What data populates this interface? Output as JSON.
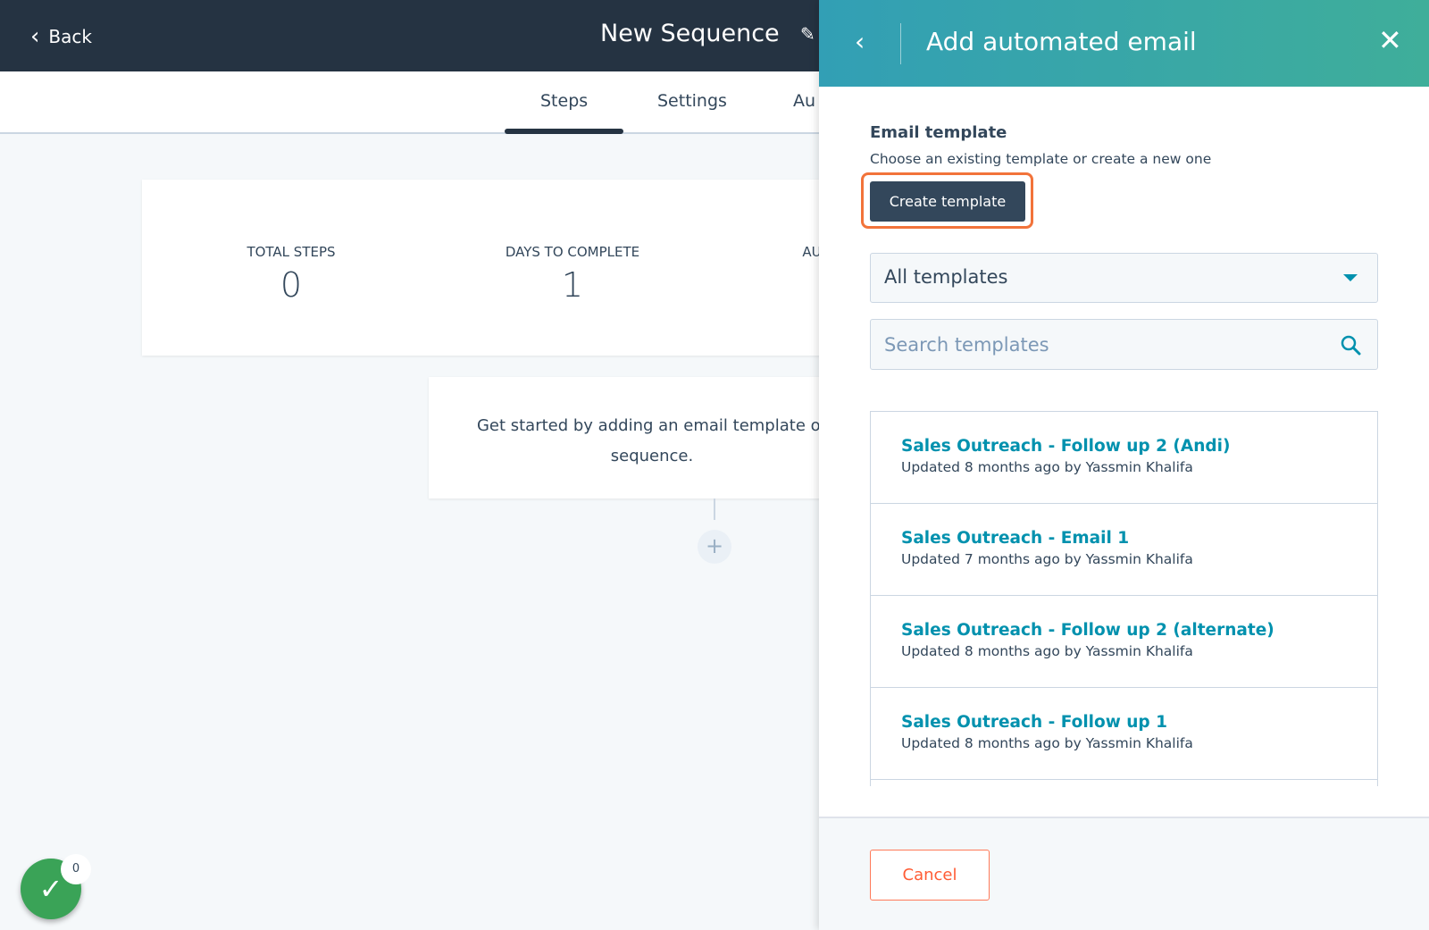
{
  "header": {
    "back_label": "Back",
    "title": "New Sequence"
  },
  "tabs": [
    {
      "label": "Steps",
      "active": true
    },
    {
      "label": "Settings"
    },
    {
      "label": "Au"
    }
  ],
  "stats": [
    {
      "label": "TOTAL STEPS",
      "value": "0"
    },
    {
      "label": "DAYS TO COMPLETE",
      "value": "1"
    },
    {
      "label": "AU",
      "value": ""
    }
  ],
  "empty_state": {
    "line1": "Get started by adding an email template or",
    "line2": "sequence."
  },
  "tasks_badge": {
    "count": "0"
  },
  "panel": {
    "title": "Add automated email",
    "section_title": "Email template",
    "section_subtitle": "Choose an existing template or create a new one",
    "create_label": "Create template",
    "filter_value": "All templates",
    "search_placeholder": "Search templates",
    "templates": [
      {
        "name": "Sales Outreach - Follow up 2 (Andi)",
        "meta": "Updated 8 months ago by Yassmin Khalifa"
      },
      {
        "name": "Sales Outreach - Email 1",
        "meta": "Updated 7 months ago by Yassmin Khalifa"
      },
      {
        "name": "Sales Outreach - Follow up 2 (alternate)",
        "meta": "Updated 8 months ago by Yassmin Khalifa"
      },
      {
        "name": "Sales Outreach - Follow up 1",
        "meta": "Updated 8 months ago by Yassmin Khalifa"
      }
    ],
    "cancel_label": "Cancel"
  },
  "colors": {
    "accent": "#0091ae",
    "highlight": "#f2733a",
    "header": "#253342",
    "success": "#3aa357"
  }
}
